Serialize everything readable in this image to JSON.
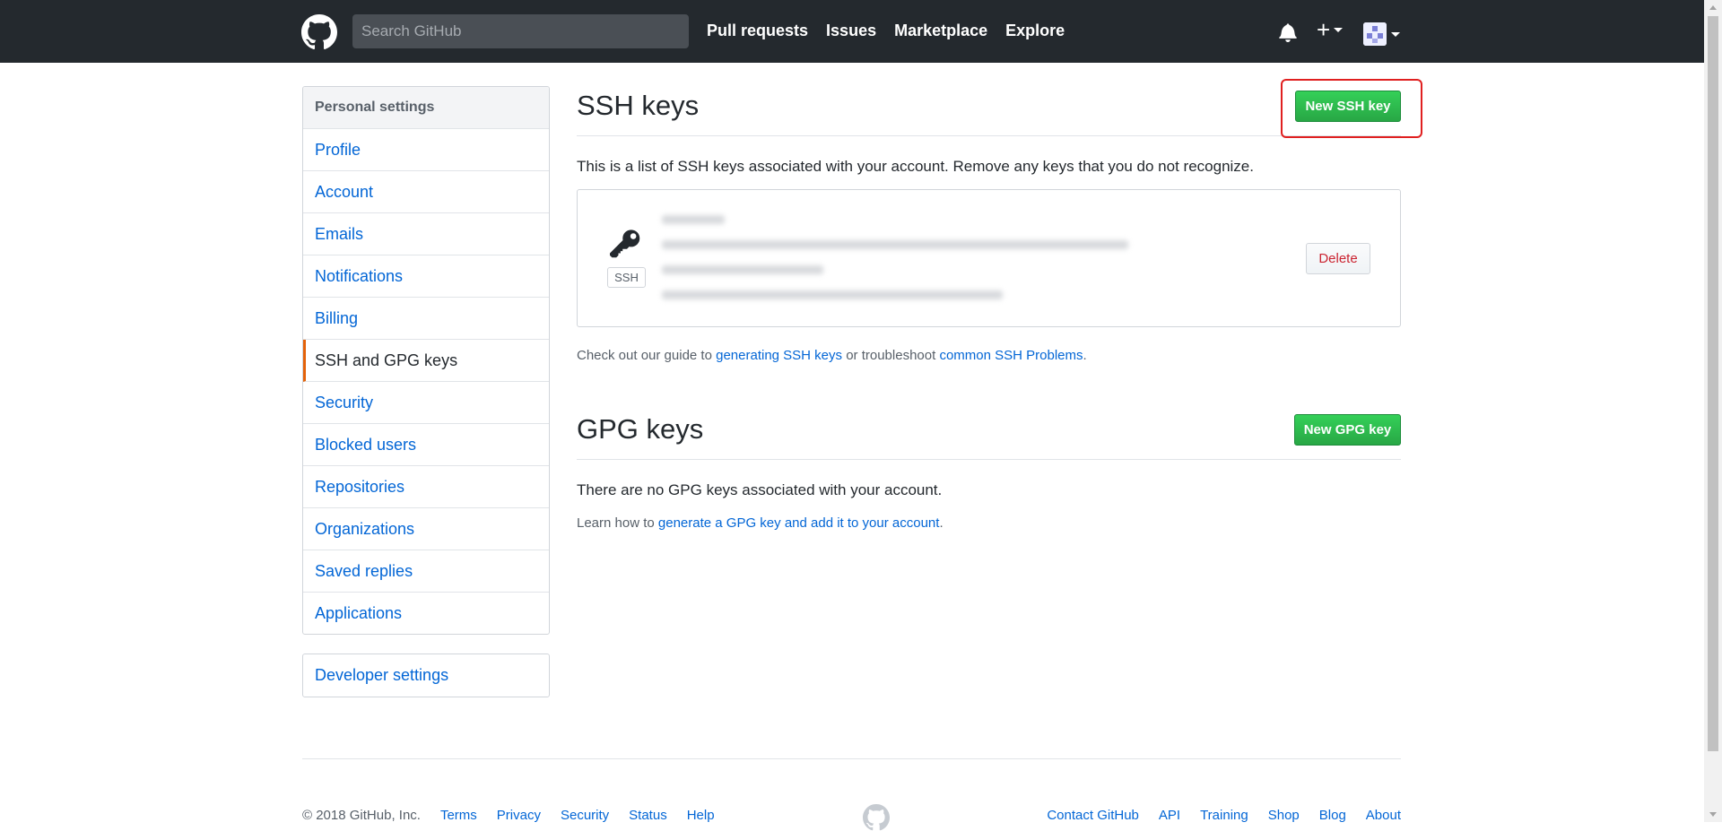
{
  "header": {
    "search_placeholder": "Search GitHub",
    "nav": [
      "Pull requests",
      "Issues",
      "Marketplace",
      "Explore"
    ]
  },
  "sidebar": {
    "heading": "Personal settings",
    "items": [
      {
        "label": "Profile"
      },
      {
        "label": "Account"
      },
      {
        "label": "Emails"
      },
      {
        "label": "Notifications"
      },
      {
        "label": "Billing"
      },
      {
        "label": "SSH and GPG keys",
        "selected": true
      },
      {
        "label": "Security"
      },
      {
        "label": "Blocked users"
      },
      {
        "label": "Repositories"
      },
      {
        "label": "Organizations"
      },
      {
        "label": "Saved replies"
      },
      {
        "label": "Applications"
      }
    ],
    "developer_settings": "Developer settings"
  },
  "ssh": {
    "title": "SSH keys",
    "new_button": "New SSH key",
    "description": "This is a list of SSH keys associated with your account. Remove any keys that you do not recognize.",
    "key_type": "SSH",
    "delete_button": "Delete",
    "guide_prefix": "Check out our guide to ",
    "guide_link": "generating SSH keys",
    "guide_middle": " or troubleshoot ",
    "guide_link2": "common SSH Problems",
    "guide_suffix": "."
  },
  "gpg": {
    "title": "GPG keys",
    "new_button": "New GPG key",
    "empty_text": "There are no GPG keys associated with your account.",
    "learn_prefix": "Learn how to ",
    "learn_link": "generate a GPG key and add it to your account",
    "learn_suffix": "."
  },
  "footer": {
    "copyright": "© 2018 GitHub, Inc.",
    "left_links": [
      "Terms",
      "Privacy",
      "Security",
      "Status",
      "Help"
    ],
    "right_links": [
      "Contact GitHub",
      "API",
      "Training",
      "Shop",
      "Blog",
      "About"
    ]
  },
  "colors": {
    "header_bg": "#24292e",
    "link": "#0366d6",
    "green": "#28a745",
    "highlight": "#e02020",
    "selected_border": "#e36209"
  }
}
